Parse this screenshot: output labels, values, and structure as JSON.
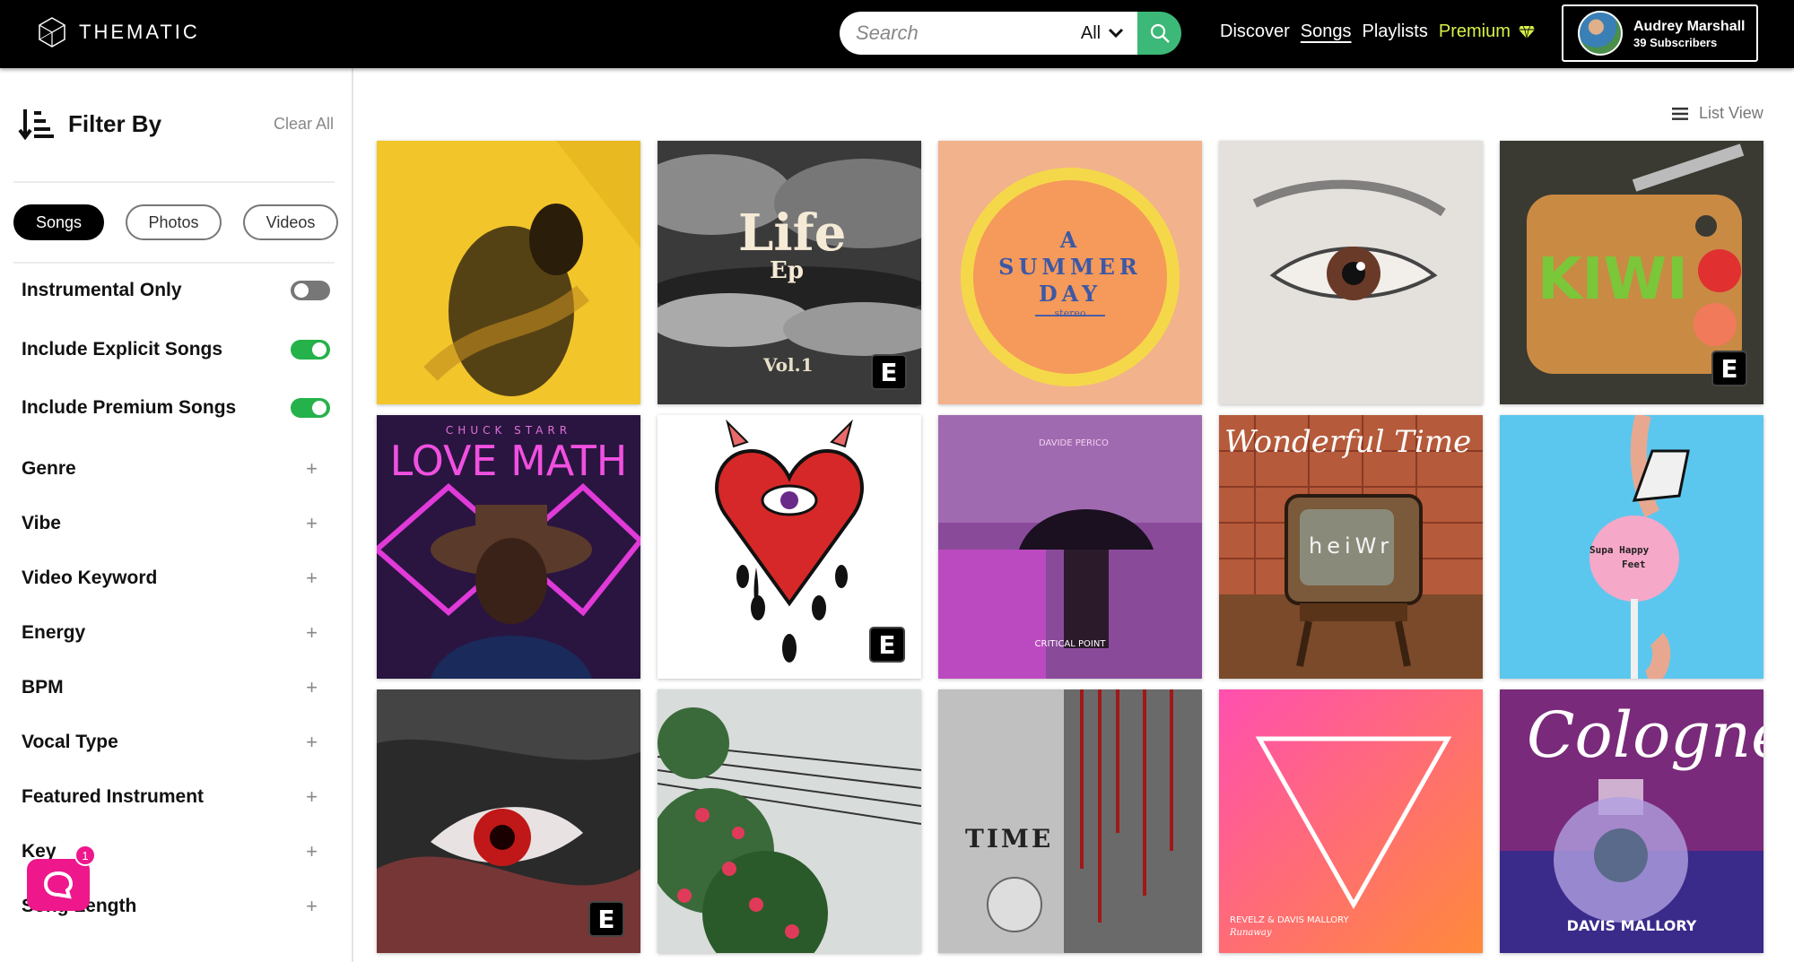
{
  "brand": {
    "name": "THEMATIC"
  },
  "search": {
    "placeholder": "Search",
    "scope": "All"
  },
  "nav": {
    "discover": "Discover",
    "songs": "Songs",
    "playlists": "Playlists",
    "premium": "Premium"
  },
  "user": {
    "name": "Audrey Marshall",
    "subscribers": "39 Subscribers"
  },
  "sidebar": {
    "title": "Filter By",
    "clear_all": "Clear All",
    "media_tabs": [
      "Songs",
      "Photos",
      "Videos"
    ],
    "active_tab": "Songs",
    "toggles": [
      {
        "label": "Instrumental Only",
        "on": false
      },
      {
        "label": "Include Explicit Songs",
        "on": true
      },
      {
        "label": "Include Premium Songs",
        "on": true
      }
    ],
    "filters": [
      "Genre",
      "Vibe",
      "Video Keyword",
      "Energy",
      "BPM",
      "Vocal Type",
      "Featured Instrument",
      "Key",
      "Song Length"
    ],
    "chat_badge": "1"
  },
  "main": {
    "view_toggle": "List View",
    "explicit_badge": "E",
    "albums": [
      {
        "title": "",
        "explicit": false
      },
      {
        "title": "Life",
        "subtitle": "Ep",
        "volume": "Vol.1",
        "explicit": true
      },
      {
        "title": "A",
        "subtitle": "SUMMER",
        "line3": "DAY",
        "tag": "stereo",
        "explicit": false
      },
      {
        "title": "",
        "explicit": false
      },
      {
        "title": "KIWI",
        "explicit": true
      },
      {
        "title": "LOVE MATH",
        "subtitle": "CHUCK STARR",
        "explicit": false
      },
      {
        "title": "",
        "explicit": true
      },
      {
        "title": "CRITICAL POINT",
        "subtitle": "DAVIDE PERICO",
        "explicit": false
      },
      {
        "title": "Wonderful Time",
        "subtitle": "heiWr",
        "explicit": false
      },
      {
        "title": "Supa Happy",
        "subtitle": "Feet",
        "explicit": false
      },
      {
        "title": "",
        "explicit": true
      },
      {
        "title": "",
        "explicit": false
      },
      {
        "title": "TIME",
        "explicit": false
      },
      {
        "title": "REVELZ & DAVIS MALLORY",
        "subtitle": "Runaway",
        "explicit": false
      },
      {
        "title": "Cologne",
        "subtitle": "DAVIS MALLORY",
        "explicit": false
      }
    ]
  },
  "colors": {
    "accent_green": "#3cb878",
    "premium_yellow": "#d8f04a",
    "toggle_on": "#25b24b",
    "chat_pink": "#ee178c"
  }
}
